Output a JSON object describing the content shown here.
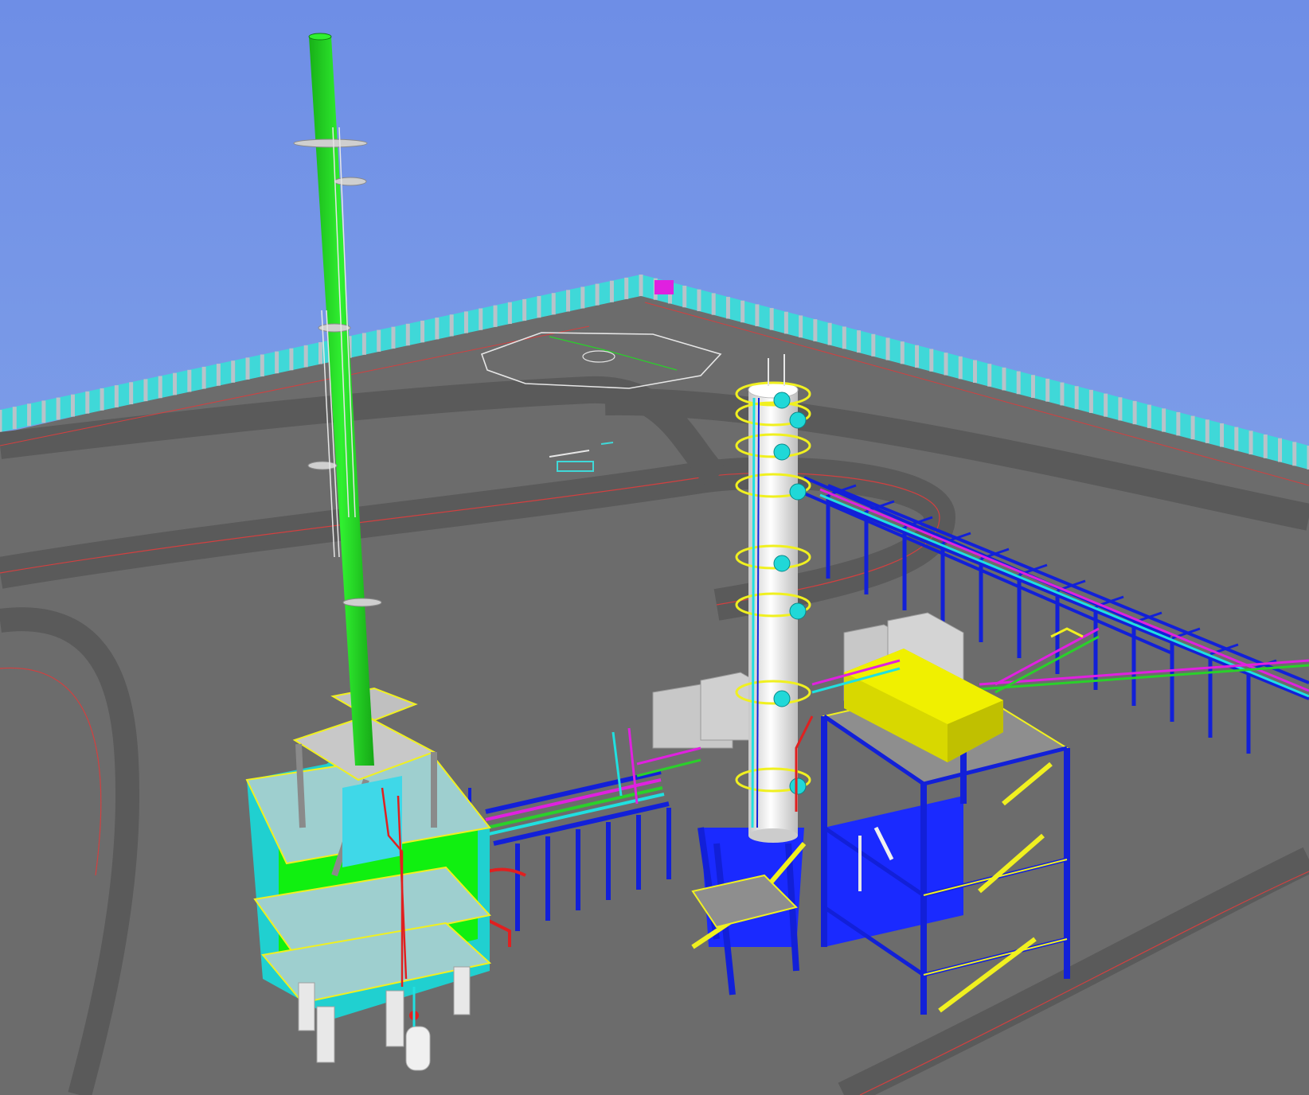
{
  "viewport": {
    "view": "isometric-3d",
    "colors": {
      "sky_top": "#6e8ee6",
      "sky_bottom": "#8fb0ea",
      "ground": "#6c6c6c",
      "road": "#5e5e5e",
      "road_edge": "#d24040",
      "fence": "#3fd8d8",
      "fence_post": "#b9c2c9",
      "flare_stack": "#1fe01f",
      "steel_structure": "#1220d8",
      "handrail": "#f0f020",
      "vessel": "#f0f0f0",
      "nozzle": "#20d8d8",
      "package_unit": "#f0f000",
      "pipe_magenta": "#e020e0",
      "pipe_red": "#e02020",
      "pipe_cyan": "#20e0e0",
      "shelter": "#c8c8c8",
      "cladding_green": "#10f010",
      "cladding_cyan": "#20d0d0",
      "gate_marker": "#e020e0"
    },
    "objects": {
      "flare": "flare-stack",
      "tower": "distillation-column",
      "racks": "pipe-rack",
      "fence": "perimeter-fence",
      "helipad": "helipad-marking",
      "package": "yellow-package-unit"
    }
  }
}
